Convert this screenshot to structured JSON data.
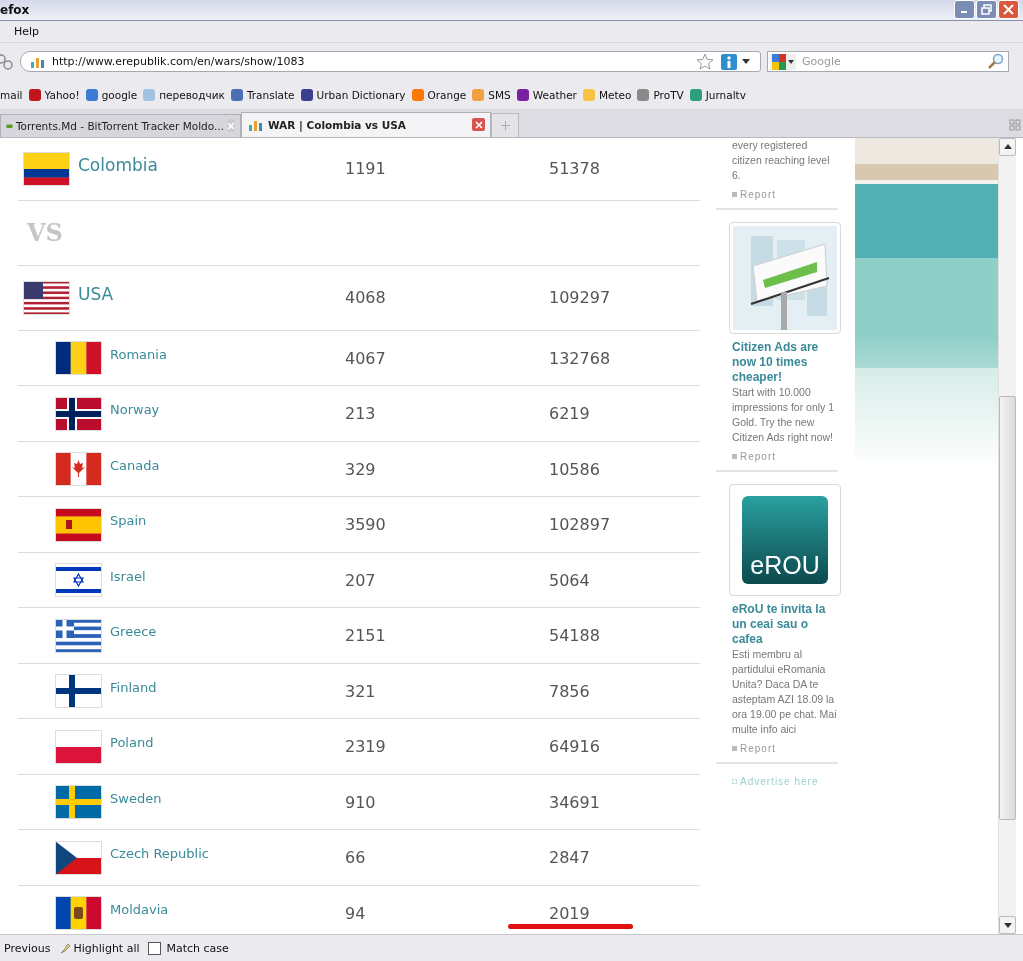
{
  "window": {
    "title": "efox"
  },
  "menu": [
    "Help"
  ],
  "address_bar": {
    "url": "http://www.erepublik.com/en/wars/show/1083"
  },
  "search": {
    "placeholder": "Google"
  },
  "bookmarks": [
    {
      "label": "mail"
    },
    {
      "label": "Yahoo!"
    },
    {
      "label": "google"
    },
    {
      "label": "переводчик"
    },
    {
      "label": "Translate"
    },
    {
      "label": "Urban Dictionary"
    },
    {
      "label": "Orange"
    },
    {
      "label": "SMS"
    },
    {
      "label": "Weather"
    },
    {
      "label": "Meteo"
    },
    {
      "label": "ProTV"
    },
    {
      "label": "Jurnaltv"
    }
  ],
  "tabs": [
    {
      "label": "Torrents.Md - BitTorrent Tracker Moldo...",
      "selected": false
    },
    {
      "label": "WAR | Colombia vs USA",
      "selected": true
    }
  ],
  "war": {
    "defender": {
      "name": "Colombia",
      "column_2": "1191",
      "column_3": "51378"
    },
    "separator": "VS",
    "attacker": {
      "name": "USA",
      "column_2": "4068",
      "column_3": "109297"
    },
    "allies": [
      {
        "name": "Romania",
        "column_2": "4067",
        "column_3": "132768",
        "underlined": false
      },
      {
        "name": "Norway",
        "column_2": "213",
        "column_3": "6219",
        "underlined": false
      },
      {
        "name": "Canada",
        "column_2": "329",
        "column_3": "10586",
        "underlined": false
      },
      {
        "name": "Spain",
        "column_2": "3590",
        "column_3": "102897",
        "underlined": false
      },
      {
        "name": "Israel",
        "column_2": "207",
        "column_3": "5064",
        "underlined": false
      },
      {
        "name": "Greece",
        "column_2": "2151",
        "column_3": "54188",
        "underlined": false
      },
      {
        "name": "Finland",
        "column_2": "321",
        "column_3": "7856",
        "underlined": false
      },
      {
        "name": "Poland",
        "column_2": "2319",
        "column_3": "64916",
        "underlined": false
      },
      {
        "name": "Sweden",
        "column_2": "910",
        "column_3": "34691",
        "underlined": false
      },
      {
        "name": "Czech Republic",
        "column_2": "66",
        "column_3": "2847",
        "underlined": false
      },
      {
        "name": "Moldavia",
        "column_2": "94",
        "column_3": "2019",
        "underlined": true
      }
    ]
  },
  "sidebar": {
    "lead_text": "every registered citizen reaching level 6.",
    "lead_report": "Report",
    "ads": [
      {
        "kind": "picture",
        "title": "Citizen Ads are now 10 times cheaper!",
        "body": "Start with 10.000 impressions for only 1 Gold. Try the new Citizen Ads right now!",
        "report": "Report"
      },
      {
        "kind": "logo",
        "logo_text": "eROU",
        "title": "eRoU te invita la un ceai sau o cafea",
        "body": "Esti membru al partidului eRomania Unita? Daca DA te asteptam AZI 18.09 la ora 19.00 pe chat. Mai multe info aici",
        "report": "Report"
      }
    ],
    "advertise": "Advertise here"
  },
  "find_bar": {
    "previous": "Previous",
    "highlight": "Highlight all",
    "match_case": {
      "label": "Match case",
      "checked": false
    }
  }
}
